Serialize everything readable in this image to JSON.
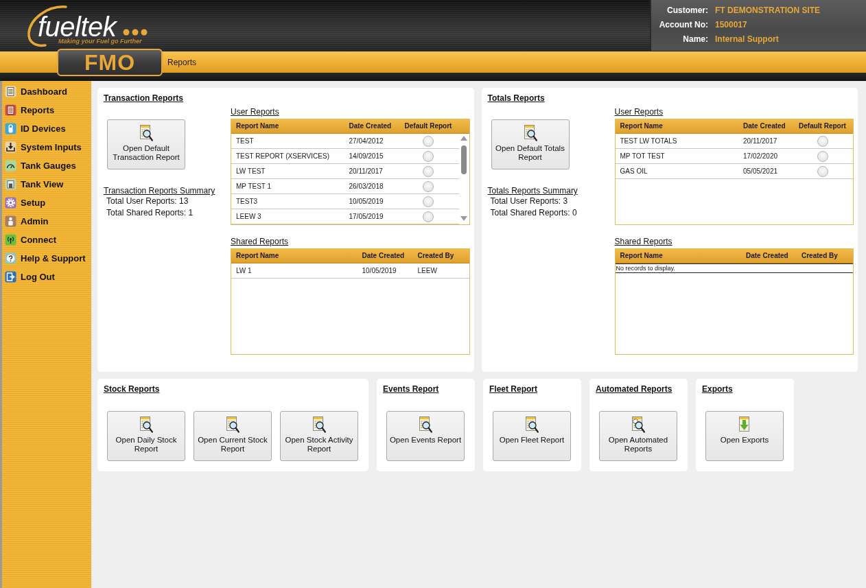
{
  "header": {
    "logo": {
      "wordmark": "fueltek",
      "tagline": "Making your Fuel go Further"
    },
    "app_name": "FMO",
    "breadcrumb": "Reports",
    "account": [
      {
        "label": "Customer:",
        "value": "FT DEMONSTRATION SITE"
      },
      {
        "label": "Account No:",
        "value": "1500017"
      },
      {
        "label": "Name:",
        "value": "Internal Support"
      }
    ]
  },
  "sidebar": {
    "items": [
      {
        "label": "Dashboard",
        "kind": "dashboard"
      },
      {
        "label": "Reports",
        "kind": "reports"
      },
      {
        "label": "ID Devices",
        "kind": "devices"
      },
      {
        "label": "System Inputs",
        "kind": "inputs"
      },
      {
        "label": "Tank Gauges",
        "kind": "gauges"
      },
      {
        "label": "Tank View",
        "kind": "tank"
      },
      {
        "label": "Setup",
        "kind": "setup"
      },
      {
        "label": "Admin",
        "kind": "admin"
      },
      {
        "label": "Connect",
        "kind": "connect"
      },
      {
        "label": "Help & Support",
        "kind": "help"
      },
      {
        "label": "Log Out",
        "kind": "logout"
      }
    ]
  },
  "report_panels": [
    {
      "title": "Transaction Reports",
      "open_button": {
        "label": "Open Default Transaction Report",
        "kind": "report"
      },
      "summary": {
        "title": "Transaction Reports Summary",
        "lines": [
          "Total User Reports: 13",
          "Total Shared Reports: 1"
        ]
      },
      "user_reports": {
        "title": "User Reports",
        "columns": [
          "Report Name",
          "Date Created",
          "Default Report"
        ],
        "rows": [
          {
            "name": "TEST",
            "date": "27/04/2012",
            "default": false
          },
          {
            "name": "TEST REPORT (XSERVICES)",
            "date": "14/09/2015",
            "default": false
          },
          {
            "name": "LW TEST",
            "date": "20/11/2017",
            "default": false
          },
          {
            "name": "MP TEST 1",
            "date": "26/03/2018",
            "default": false
          },
          {
            "name": "TEST3",
            "date": "10/05/2019",
            "default": false
          },
          {
            "name": "LEEW 3",
            "date": "17/05/2019",
            "default": false
          }
        ]
      },
      "shared_reports": {
        "title": "Shared Reports",
        "columns": [
          "Report Name",
          "Date Created",
          "Created By"
        ],
        "rows": [
          {
            "name": "LW 1",
            "date": "10/05/2019",
            "created_by": "LEEW"
          }
        ]
      }
    },
    {
      "title": "Totals Reports",
      "open_button": {
        "label": "Open Default Totals Report",
        "kind": "report"
      },
      "summary": {
        "title": "Totals Reports Summary",
        "lines": [
          "Total User Reports: 3",
          "Total Shared Reports: 0"
        ]
      },
      "user_reports": {
        "title": "User Reports",
        "columns": [
          "Report Name",
          "Date Created",
          "Default Report"
        ],
        "rows": [
          {
            "name": "TEST LW TOTALS",
            "date": "20/11/2017",
            "default": false
          },
          {
            "name": "MP TOT TEST",
            "date": "17/02/2020",
            "default": false
          },
          {
            "name": "GAS OIL",
            "date": "05/05/2021",
            "default": false
          }
        ]
      },
      "shared_reports": {
        "title": "Shared Reports",
        "columns": [
          "Report Name",
          "Date Created",
          "Created By"
        ],
        "empty_message": "No records to display."
      }
    }
  ],
  "report_sections": [
    {
      "title": "Stock Reports",
      "buttons": [
        {
          "label": "Open Daily Stock Report",
          "kind": "report"
        },
        {
          "label": "Open Current Stock Report",
          "kind": "report"
        },
        {
          "label": "Open Stock Activity Report",
          "kind": "report"
        }
      ]
    },
    {
      "title": "Events Report",
      "buttons": [
        {
          "label": "Open Events Report",
          "kind": "report"
        }
      ]
    },
    {
      "title": "Fleet Report",
      "buttons": [
        {
          "label": "Open Fleet Report",
          "kind": "report"
        }
      ]
    },
    {
      "title": "Automated Reports",
      "buttons": [
        {
          "label": "Open Automated Reports",
          "kind": "automated"
        }
      ]
    },
    {
      "title": "Exports",
      "buttons": [
        {
          "label": "Open Exports",
          "kind": "export"
        }
      ]
    }
  ]
}
